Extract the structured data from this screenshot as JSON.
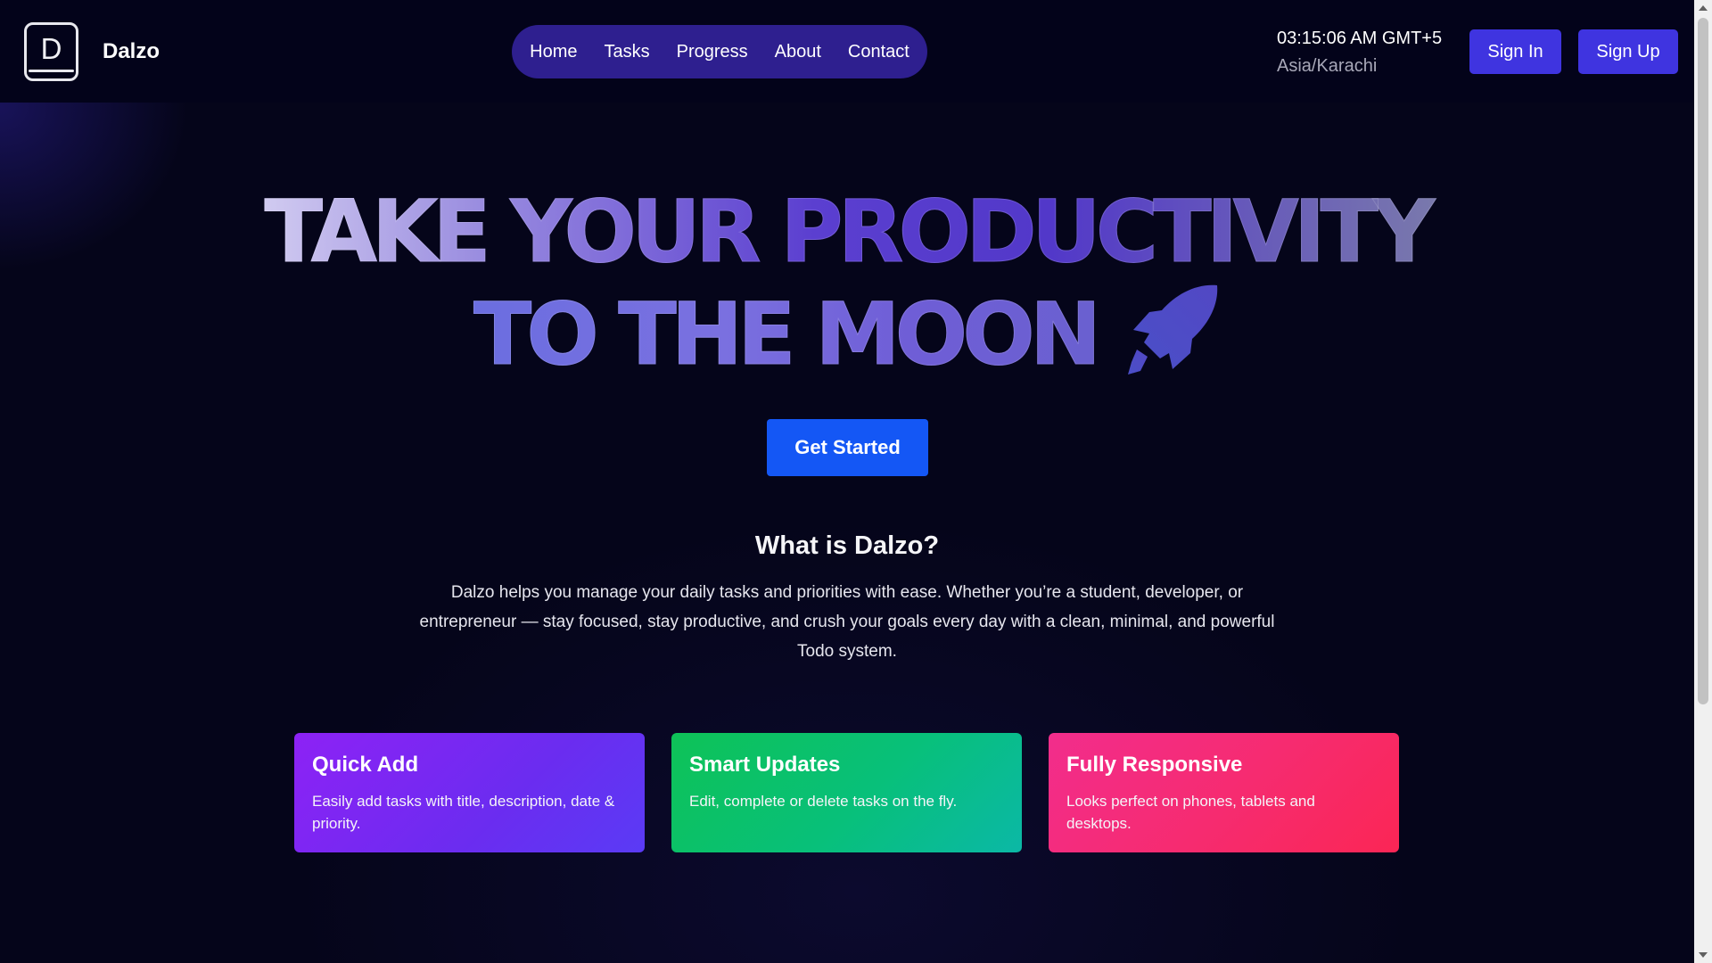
{
  "header": {
    "logo_letter": "D",
    "brand": "Dalzo",
    "nav": [
      "Home",
      "Tasks",
      "Progress",
      "About",
      "Contact"
    ],
    "clock": {
      "time": "03:15:06 AM GMT+5",
      "zone": "Asia/Karachi"
    },
    "sign_in": "Sign In",
    "sign_up": "Sign Up"
  },
  "hero": {
    "line1": "TAKE YOUR PRODUCTIVITY",
    "line2": "TO THE MOON",
    "line2_icon": "rocket-icon",
    "cta": "Get Started"
  },
  "about": {
    "title": "What is Dalzo?",
    "text": "Dalzo helps you manage your daily tasks and priorities with ease. Whether you’re a student, developer, or entrepreneur — stay focused, stay productive, and crush your goals every day with a clean, minimal, and powerful Todo system."
  },
  "features": [
    {
      "title": "Quick Add",
      "desc": "Easily add tasks with title, description, date & priority."
    },
    {
      "title": "Smart Updates",
      "desc": "Edit, complete or delete tasks on the fly."
    },
    {
      "title": "Fully Responsive",
      "desc": "Looks perfect on phones, tablets and desktops."
    }
  ],
  "colors": {
    "background": "#05051a",
    "nav_pill": "#2e1f8f",
    "auth_button": "#3f34e0",
    "cta_button": "#1457f5",
    "card_quick_add": "#8d22f5",
    "card_smart_updates": "#0ec257",
    "card_fully_responsive": "#f22d8c"
  }
}
